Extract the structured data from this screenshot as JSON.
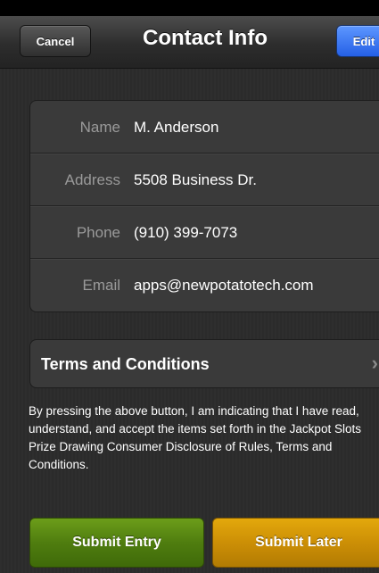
{
  "navbar": {
    "title": "Contact Info",
    "cancel_label": "Cancel",
    "edit_label": "Edit"
  },
  "contact": {
    "rows": [
      {
        "label": "Name",
        "value": "M. Anderson"
      },
      {
        "label": "Address",
        "value": "5508 Business Dr."
      },
      {
        "label": "Phone",
        "value": "(910) 399-7073"
      },
      {
        "label": "Email",
        "value": "apps@newpotatotech.com"
      }
    ]
  },
  "terms": {
    "label": "Terms and Conditions",
    "chevron_icon": "chevron-right-icon"
  },
  "disclaimer": "By pressing the above button, I am indicating that I have read, understand, and accept the items set forth in the Jackpot Slots Prize Drawing Consumer Disclosure of Rules, Terms and Conditions.",
  "actions": {
    "submit_entry_label": "Submit Entry",
    "submit_later_label": "Submit Later"
  },
  "colors": {
    "edit_button": "#2f6cf0",
    "submit_entry": "#4f7d0f",
    "submit_later": "#cc8f06"
  }
}
